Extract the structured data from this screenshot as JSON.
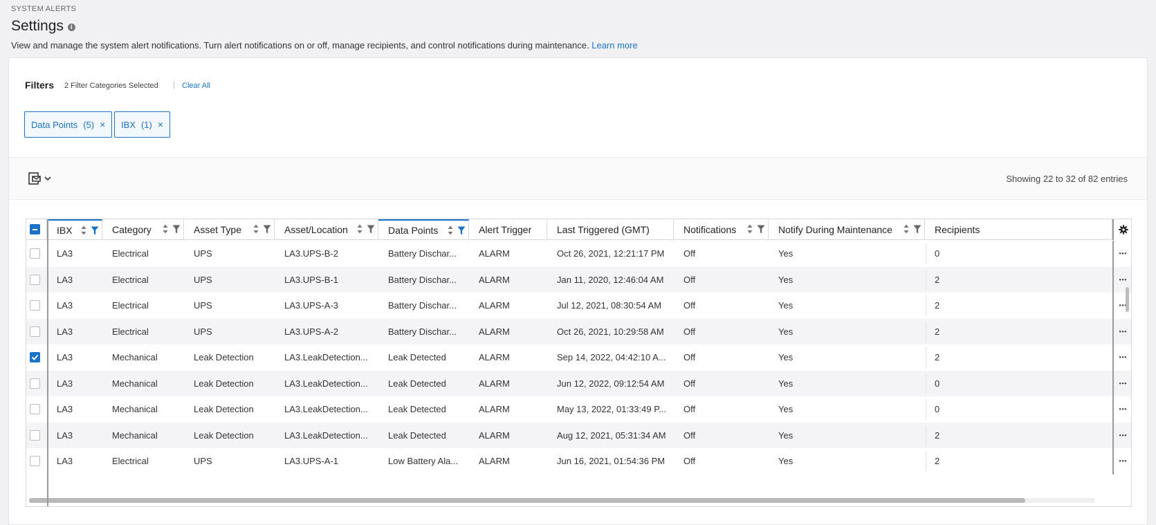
{
  "header": {
    "section_label": "SYSTEM ALERTS",
    "title": "Settings",
    "info_glyph": "i",
    "description": "View and manage the system alert notifications. Turn alert notifications on or off, manage recipients, and control notifications during maintenance.",
    "learn_more": "Learn more"
  },
  "filters": {
    "title": "Filters",
    "count_text": "2 Filter Categories Selected",
    "separator": "|",
    "clear_all": "Clear All",
    "chips": [
      {
        "label": "Data Points",
        "count": "(5)",
        "close": "×"
      },
      {
        "label": "IBX",
        "count": "(1)",
        "close": "×"
      }
    ]
  },
  "toolbar": {
    "export_icon": "mail-export-icon",
    "entries_text": "Showing 22 to 32 of 82 entries"
  },
  "table": {
    "columns": [
      {
        "label": "IBX",
        "sortable": true,
        "filterable": true,
        "filter_active": true,
        "active": true
      },
      {
        "label": "Category",
        "sortable": true,
        "filterable": true
      },
      {
        "label": "Asset Type",
        "sortable": true,
        "filterable": true
      },
      {
        "label": "Asset/Location",
        "sortable": true,
        "filterable": true
      },
      {
        "label": "Data Points",
        "sortable": true,
        "filterable": true,
        "filter_active": true,
        "active": true
      },
      {
        "label": "Alert Trigger",
        "sortable": false,
        "filterable": false
      },
      {
        "label": "Last Triggered (GMT)",
        "sortable": false,
        "filterable": false
      },
      {
        "label": "Notifications",
        "sortable": true,
        "filterable": true
      },
      {
        "label": "Notify During Maintenance",
        "sortable": true,
        "filterable": true
      },
      {
        "label": "Recipients",
        "sortable": false,
        "filterable": false
      }
    ],
    "more_glyph": "•••",
    "rows": [
      {
        "checked": false,
        "cells": [
          "LA3",
          "Electrical",
          "UPS",
          "LA3.UPS-B-2",
          "Battery Dischar...",
          "ALARM",
          "Oct 26, 2021, 12:21:17 PM",
          "Off",
          "Yes",
          "0"
        ]
      },
      {
        "checked": false,
        "cells": [
          "LA3",
          "Electrical",
          "UPS",
          "LA3.UPS-B-1",
          "Battery Dischar...",
          "ALARM",
          "Jan 11, 2020, 12:46:04 AM",
          "Off",
          "Yes",
          "2"
        ]
      },
      {
        "checked": false,
        "cells": [
          "LA3",
          "Electrical",
          "UPS",
          "LA3.UPS-A-3",
          "Battery Dischar...",
          "ALARM",
          "Jul 12, 2021, 08:30:54 AM",
          "Off",
          "Yes",
          "2"
        ]
      },
      {
        "checked": false,
        "cells": [
          "LA3",
          "Electrical",
          "UPS",
          "LA3.UPS-A-2",
          "Battery Dischar...",
          "ALARM",
          "Oct 26, 2021, 10:29:58 AM",
          "Off",
          "Yes",
          "2"
        ]
      },
      {
        "checked": true,
        "cells": [
          "LA3",
          "Mechanical",
          "Leak Detection",
          "LA3.LeakDetection...",
          "Leak Detected",
          "ALARM",
          "Sep 14, 2022, 04:42:10 A...",
          "Off",
          "Yes",
          "2"
        ]
      },
      {
        "checked": false,
        "cells": [
          "LA3",
          "Mechanical",
          "Leak Detection",
          "LA3.LeakDetection...",
          "Leak Detected",
          "ALARM",
          "Jun 12, 2022, 09:12:54 AM",
          "Off",
          "Yes",
          "0"
        ]
      },
      {
        "checked": false,
        "cells": [
          "LA3",
          "Mechanical",
          "Leak Detection",
          "LA3.LeakDetection...",
          "Leak Detected",
          "ALARM",
          "May 13, 2022, 01:33:49 P...",
          "Off",
          "Yes",
          "0"
        ]
      },
      {
        "checked": false,
        "cells": [
          "LA3",
          "Mechanical",
          "Leak Detection",
          "LA3.LeakDetection...",
          "Leak Detected",
          "ALARM",
          "Aug 12, 2021, 05:31:34 AM",
          "Off",
          "Yes",
          "2"
        ]
      },
      {
        "checked": false,
        "cells": [
          "LA3",
          "Electrical",
          "UPS",
          "LA3.UPS-A-1",
          "Low Battery Ala...",
          "ALARM",
          "Jun 16, 2021, 01:54:36 PM",
          "Off",
          "Yes",
          "2"
        ]
      }
    ]
  },
  "colors": {
    "accent": "#1a73c8",
    "row_alt": "#f4f4f6",
    "border": "#d8d8dc"
  }
}
